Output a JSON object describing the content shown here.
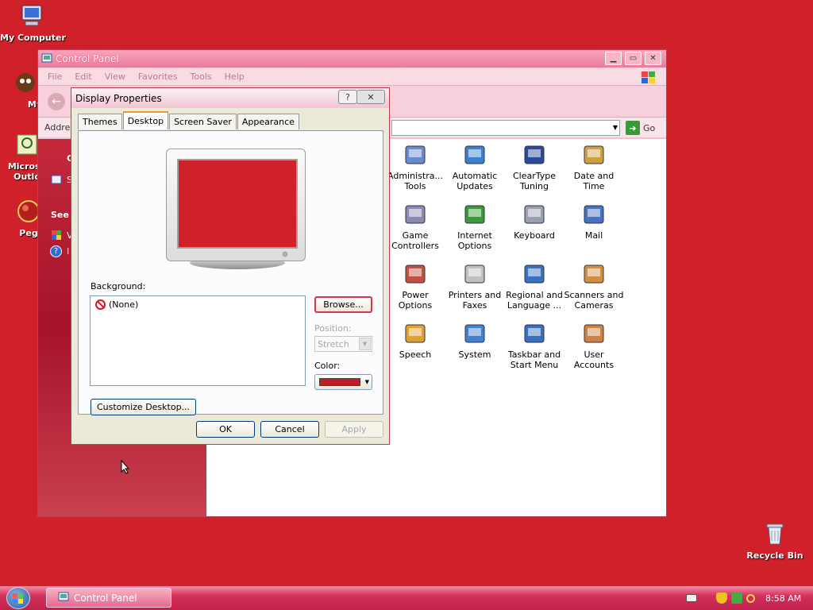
{
  "desktop": {
    "icons": [
      {
        "label": "My Computer",
        "icon": "computer-icon"
      },
      {
        "label": "MyPal",
        "icon": "mypal-icon"
      },
      {
        "label": "Microso",
        "label2": "Outlo",
        "icon": "outlook-icon"
      },
      {
        "label": "Peg",
        "icon": "peg-icon"
      },
      {
        "label": "Recycle Bin",
        "icon": "recycle-bin-icon"
      }
    ],
    "background_color": "#d0202a"
  },
  "control_panel": {
    "title": "Control Panel",
    "menu": [
      "File",
      "Edit",
      "View",
      "Favorites",
      "Tools",
      "Help"
    ],
    "address_label": "Addre",
    "go_label": "Go",
    "side_fragments": [
      "C",
      "S",
      "See A",
      "V",
      "I"
    ],
    "items": [
      {
        "line1": "Administra...",
        "line2": "Tools",
        "icon": "admin-tools-icon"
      },
      {
        "line1": "Automatic",
        "line2": "Updates",
        "icon": "automatic-updates-icon"
      },
      {
        "line1": "ClearType",
        "line2": "Tuning",
        "icon": "cleartype-icon"
      },
      {
        "line1": "Date and",
        "line2": "Time",
        "icon": "date-time-icon"
      },
      {
        "line1": "Game",
        "line2": "Controllers",
        "icon": "game-controllers-icon"
      },
      {
        "line1": "Internet",
        "line2": "Options",
        "icon": "internet-options-icon"
      },
      {
        "line1": "Keyboard",
        "line2": "",
        "icon": "keyboard-icon"
      },
      {
        "line1": "Mail",
        "line2": "",
        "icon": "mail-icon"
      },
      {
        "line1": "Power",
        "line2": "Options",
        "icon": "power-options-icon"
      },
      {
        "line1": "Printers and",
        "line2": "Faxes",
        "icon": "printers-faxes-icon"
      },
      {
        "line1": "Regional and",
        "line2": "Language ...",
        "icon": "regional-language-icon"
      },
      {
        "line1": "Scanners and",
        "line2": "Cameras",
        "icon": "scanners-cameras-icon"
      },
      {
        "line1": "Speech",
        "line2": "",
        "icon": "speech-icon"
      },
      {
        "line1": "System",
        "line2": "",
        "icon": "system-icon"
      },
      {
        "line1": "Taskbar and",
        "line2": "Start Menu",
        "icon": "taskbar-start-menu-icon"
      },
      {
        "line1": "User",
        "line2": "Accounts",
        "icon": "user-accounts-icon"
      }
    ]
  },
  "display_properties": {
    "title": "Display Properties",
    "help_label": "?",
    "close_label": "✕",
    "tabs": [
      "Themes",
      "Desktop",
      "Screen Saver",
      "Appearance"
    ],
    "active_tab": "Desktop",
    "background_label": "Background:",
    "background_items": [
      "(None)"
    ],
    "browse_label": "Browse...",
    "position_label": "Position:",
    "position_value": "Stretch",
    "color_label": "Color:",
    "color_value": "#c01c24",
    "customize_label": "Customize Desktop...",
    "ok_label": "OK",
    "cancel_label": "Cancel",
    "apply_label": "Apply"
  },
  "taskbar": {
    "task_label": "Control Panel",
    "clock": "8:58 AM"
  }
}
